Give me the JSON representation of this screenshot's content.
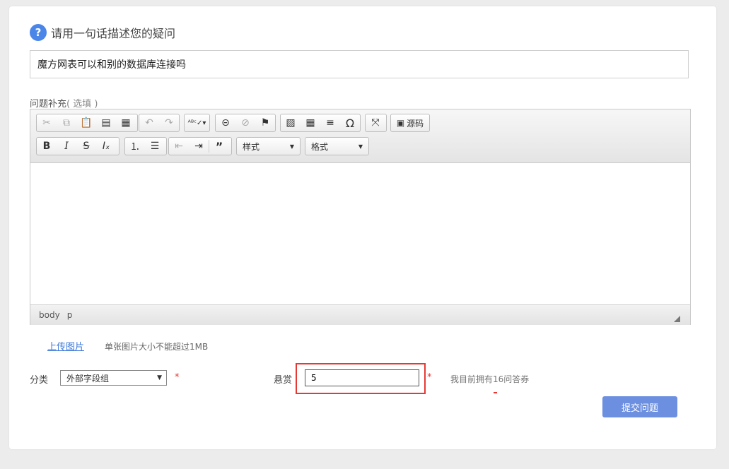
{
  "question": {
    "icon": "question-circle-icon",
    "title": "请用一句话描述您的疑问",
    "value": "魔方网表可以和别的数据库连接吗"
  },
  "supplement": {
    "label": "问题补充",
    "optional": "( 选填 )"
  },
  "editor": {
    "toolbar_row1": [
      "cut-icon",
      "copy-icon",
      "paste-icon",
      "paste-text-icon",
      "paste-word-icon",
      "undo-icon",
      "redo-icon",
      "spellcheck-icon",
      "link-icon",
      "unlink-icon",
      "anchor-icon",
      "image-icon",
      "table-icon",
      "horizontal-rule-icon",
      "special-char-icon",
      "maximize-icon",
      "source-icon"
    ],
    "source_label": "源码",
    "style_label": "样式",
    "format_label": "格式",
    "status_path": [
      "body",
      "p"
    ]
  },
  "upload": {
    "link": "上传图片",
    "hint": "单张图片大小不能超过1MB"
  },
  "category": {
    "label": "分类",
    "selected": "外部字段组"
  },
  "reward": {
    "label": "悬赏",
    "value": "5",
    "hint": "我目前拥有16问答券"
  },
  "required_mark": "*",
  "submit_label": "提交问题",
  "colors": {
    "accent": "#4a86e8",
    "submit": "#6c8fe0",
    "required": "#e53935",
    "highlight_border": "#e53935"
  }
}
